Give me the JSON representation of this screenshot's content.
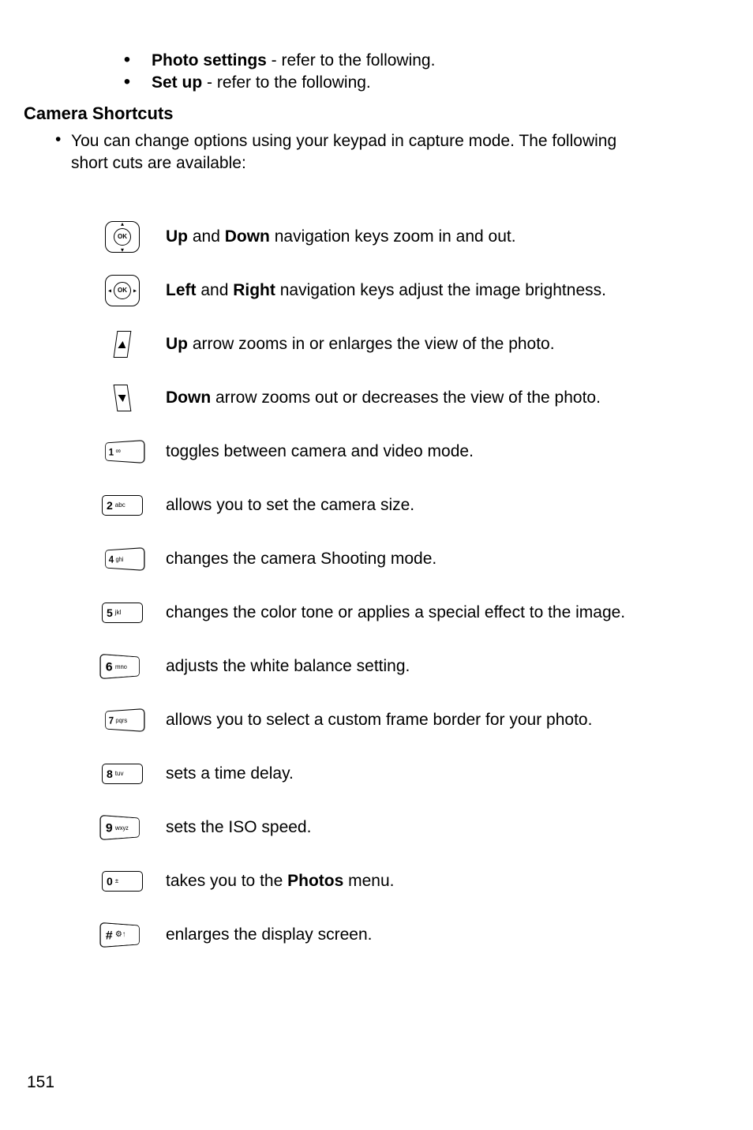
{
  "top_bullets": [
    {
      "label": "Photo settings",
      "suffix": " - refer to the following."
    },
    {
      "label": "Set up",
      "suffix": " - refer to the following."
    }
  ],
  "section_heading": "Camera Shortcuts",
  "intro": "You can change options using your keypad in capture mode. The following short cuts are available:",
  "shortcuts": [
    {
      "icon": "ok-updown",
      "pre": "",
      "b1": "Up",
      "mid1": " and ",
      "b2": "Down",
      "post": " navigation keys zoom in and out."
    },
    {
      "icon": "ok-leftright",
      "pre": "",
      "b1": "Left",
      "mid1": " and ",
      "b2": "Right",
      "post": " navigation keys adjust the image brightness."
    },
    {
      "icon": "arrow-up",
      "pre": "",
      "b1": "Up",
      "mid1": "",
      "b2": "",
      "post": " arrow zooms in or enlarges the view of the photo."
    },
    {
      "icon": "arrow-down",
      "pre": "",
      "b1": "Down",
      "mid1": "",
      "b2": "",
      "post": " arrow zooms out or decreases the view of the photo."
    },
    {
      "icon": "key-1",
      "pre": "toggles between camera and video mode.",
      "b1": "",
      "mid1": "",
      "b2": "",
      "post": ""
    },
    {
      "icon": "key-2",
      "pre": "allows you to set the camera size.",
      "b1": "",
      "mid1": "",
      "b2": "",
      "post": ""
    },
    {
      "icon": "key-4",
      "pre": "changes the camera Shooting mode.",
      "b1": "",
      "mid1": "",
      "b2": "",
      "post": ""
    },
    {
      "icon": "key-5",
      "pre": "changes the color tone or applies a special effect to the image.",
      "b1": "",
      "mid1": "",
      "b2": "",
      "post": ""
    },
    {
      "icon": "key-6",
      "pre": "adjusts the white balance setting.",
      "b1": "",
      "mid1": "",
      "b2": "",
      "post": ""
    },
    {
      "icon": "key-7",
      "pre": "allows you to select a custom frame border for your photo.",
      "b1": "",
      "mid1": "",
      "b2": "",
      "post": ""
    },
    {
      "icon": "key-8",
      "pre": "sets a time delay.",
      "b1": "",
      "mid1": "",
      "b2": "",
      "post": ""
    },
    {
      "icon": "key-9",
      "pre": "sets the ISO speed.",
      "b1": "",
      "mid1": "",
      "b2": "",
      "post": ""
    },
    {
      "icon": "key-0",
      "pre": "takes you to the ",
      "b1": "Photos",
      "mid1": "",
      "b2": "",
      "post": " menu."
    },
    {
      "icon": "key-hash",
      "pre": "enlarges the display screen.",
      "b1": "",
      "mid1": "",
      "b2": "",
      "post": ""
    }
  ],
  "keys": {
    "k1": {
      "num": "1",
      "letters": "",
      "sym": "∞"
    },
    "k2": {
      "num": "2",
      "letters": "abc"
    },
    "k4": {
      "num": "4",
      "letters": "ghi"
    },
    "k5": {
      "num": "5",
      "letters": "jkl"
    },
    "k6": {
      "num": "6",
      "letters": "mno"
    },
    "k7": {
      "num": "7",
      "letters": "pqrs"
    },
    "k8": {
      "num": "8",
      "letters": "tuv"
    },
    "k9": {
      "num": "9",
      "letters": "wxyz"
    },
    "k0": {
      "num": "0",
      "sym": "±"
    },
    "khash": {
      "num": "#",
      "sym": "⚙↑"
    }
  },
  "ok_label": "OK",
  "page_number": "151"
}
